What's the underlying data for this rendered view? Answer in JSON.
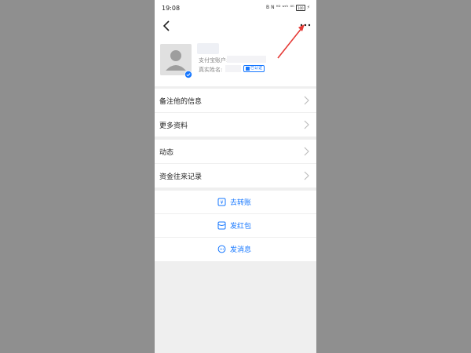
{
  "status_bar": {
    "time": "19:08",
    "icons": [
      "B",
      "N",
      "ᴴᴰ",
      "ʷᶦᶠᶦ",
      "⁴ᴳ"
    ],
    "battery": "100"
  },
  "nav": {
    "back_icon": "chevron-left-icon",
    "more_icon": "more-dots-icon"
  },
  "profile": {
    "account_label": "支付宝账户:",
    "realname_label": "真实姓名:",
    "certified_label": "已认证"
  },
  "menu_group_1": [
    {
      "label": "备注他的信息"
    },
    {
      "label": "更多资料"
    }
  ],
  "menu_group_2": [
    {
      "label": "动态"
    },
    {
      "label": "资金往来记录"
    }
  ],
  "actions": [
    {
      "label": "去转账",
      "icon": "transfer-icon"
    },
    {
      "label": "发红包",
      "icon": "red-packet-icon"
    },
    {
      "label": "发消息",
      "icon": "message-icon"
    }
  ],
  "colors": {
    "accent": "#1677ff",
    "annotation_arrow": "#e53935",
    "backdrop": "#8f8f8f"
  }
}
